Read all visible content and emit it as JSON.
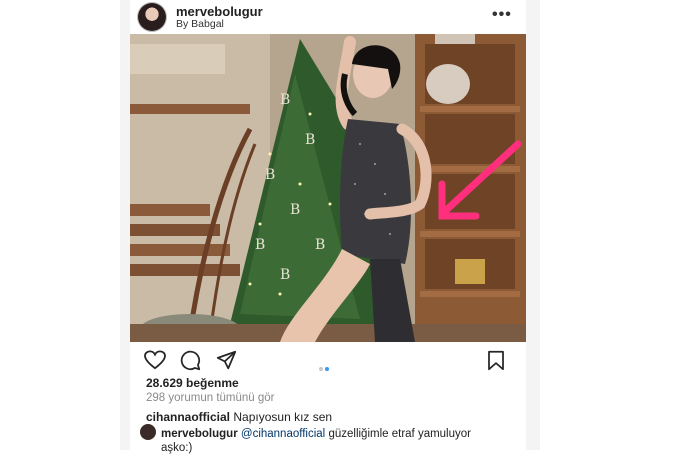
{
  "post": {
    "username": "mervebolugur",
    "subline": "By Babgal",
    "more_label": "•••"
  },
  "actions": {
    "icons": [
      "heart-icon",
      "comment-icon",
      "share-icon",
      "bookmark-icon"
    ],
    "carousel_active": 2,
    "carousel_total": 2,
    "accent": "#3897f0"
  },
  "engagement": {
    "likes": "28.629 beğenme",
    "view_comments": "298 yorumun tümünü gör"
  },
  "comments": [
    {
      "user": "cihannaofficial",
      "text": "Napıyosun kız sen"
    },
    {
      "user": "mervebolugur",
      "mention": "@cihannaofficial",
      "text": "güzelliğimle etraf yamuluyor aşko:)"
    }
  ],
  "colors": {
    "arrow": "#ff2f7d"
  }
}
